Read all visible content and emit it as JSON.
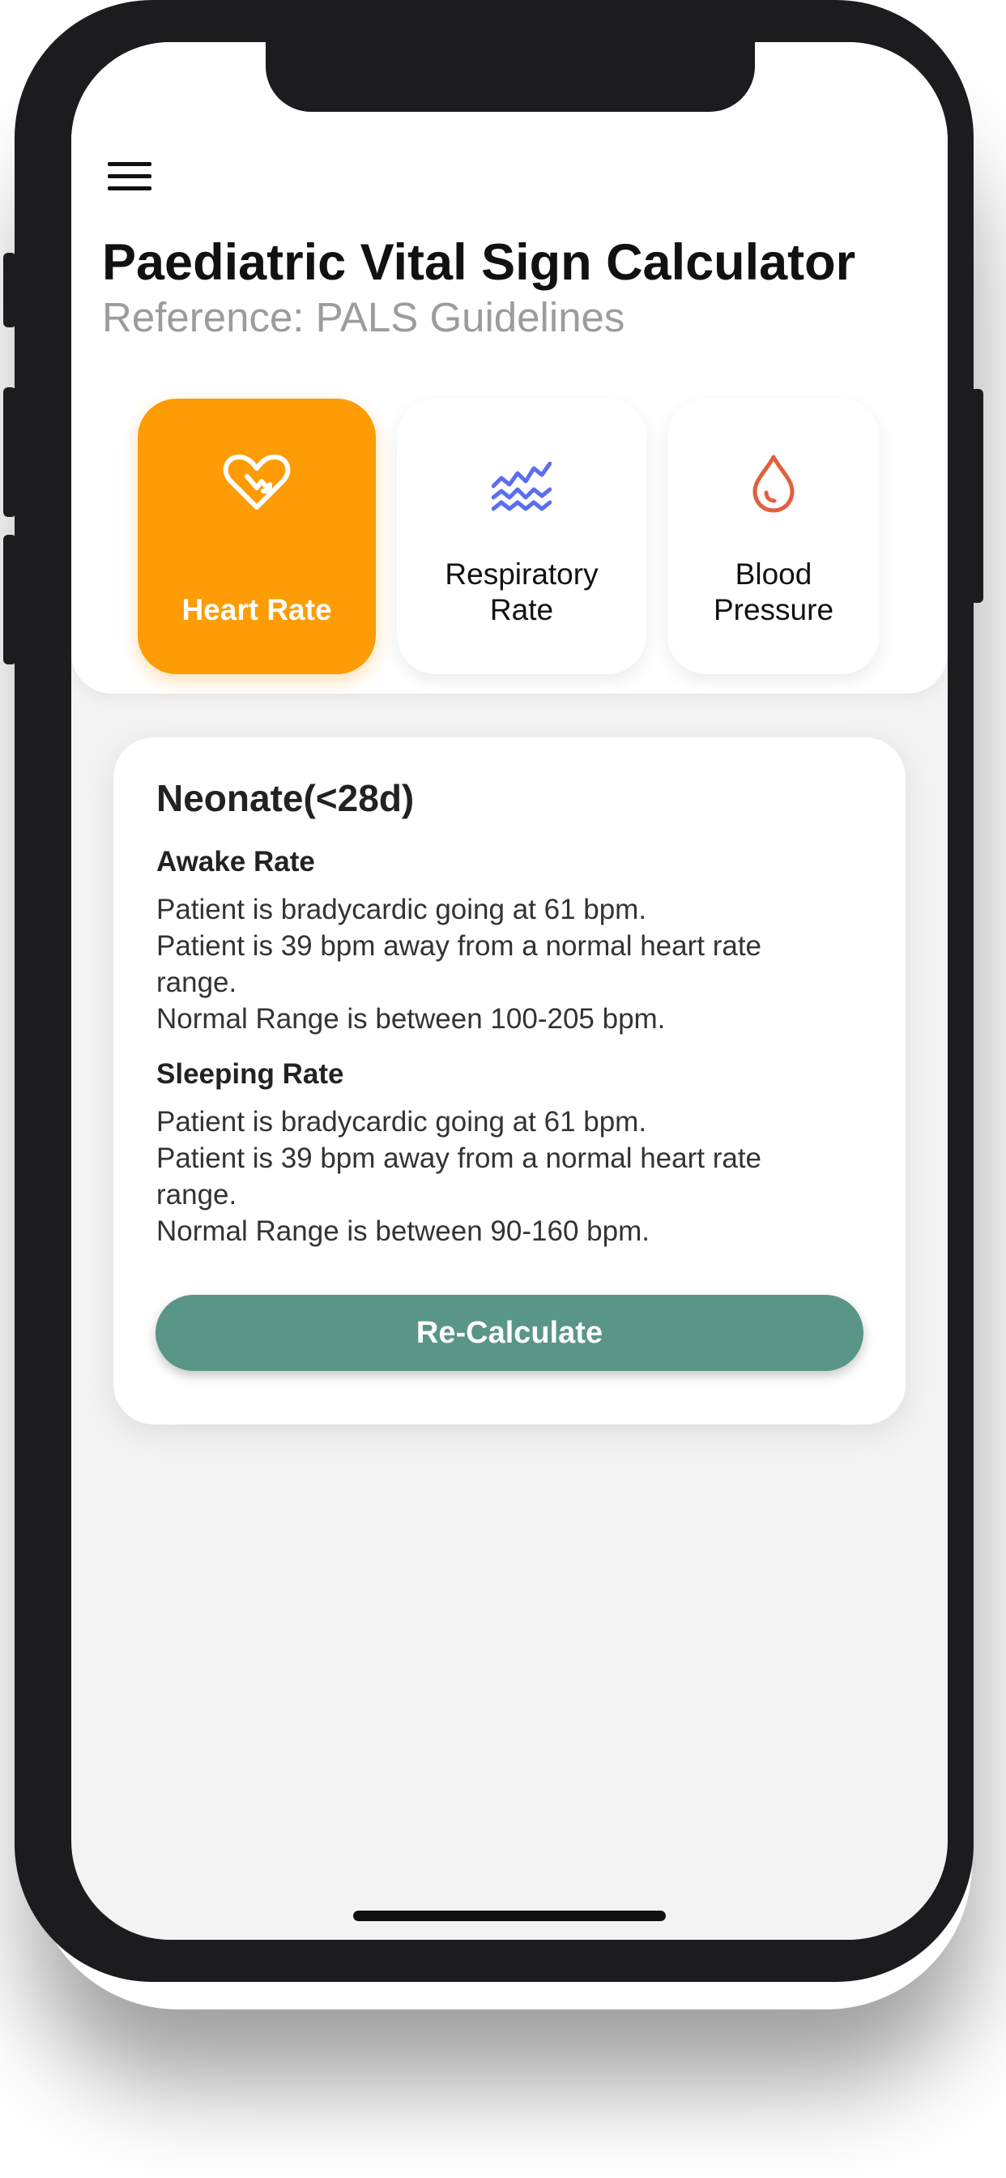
{
  "header": {
    "title": "Paediatric Vital Sign Calculator",
    "subtitle": "Reference: PALS Guidelines"
  },
  "tabs": [
    {
      "label": "Heart Rate",
      "icon": "heart-icon",
      "active": true
    },
    {
      "label_line1": "Respiratory",
      "label_line2": "Rate",
      "icon": "respiratory-wave-icon",
      "active": false
    },
    {
      "label_line1": "Blood",
      "label_line2": "Pressure",
      "icon": "blood-drop-icon",
      "active": false
    }
  ],
  "result": {
    "heading": "Neonate(<28d)",
    "awake": {
      "title": "Awake Rate",
      "line1": "Patient is bradycardic going at 61 bpm.",
      "line2": "Patient is 39 bpm away from a normal heart rate",
      "line3": "range.",
      "line4": "Normal Range is between 100-205 bpm."
    },
    "sleeping": {
      "title": "Sleeping Rate",
      "line1": "Patient is bradycardic going at 61 bpm.",
      "line2": "Patient is 39 bpm away from a normal heart rate",
      "line3": "range.",
      "line4": "Normal Range is between 90-160 bpm."
    },
    "button_label": "Re-Calculate"
  },
  "colors": {
    "accent_orange": "#fd9c05",
    "button_green": "#5a9687",
    "respiratory_blue": "#5b6ef0",
    "blood_red": "#e0603f",
    "background": "#f3f3f3"
  }
}
